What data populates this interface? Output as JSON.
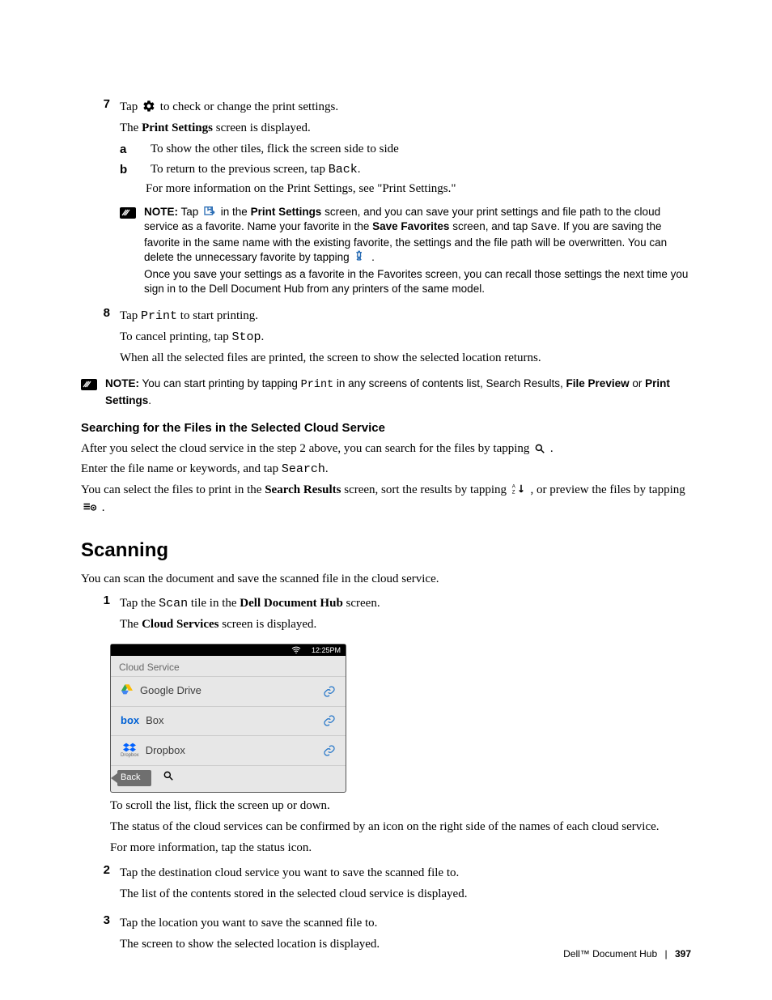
{
  "step7": {
    "num": "7",
    "line1_a": "Tap ",
    "line1_b": " to check or change the print settings.",
    "line2_a": "The ",
    "line2_bold": "Print Settings",
    "line2_b": " screen is displayed.",
    "a_num": "a",
    "a_text": "To show the other tiles, flick the screen side to side",
    "b_num": "b",
    "b_text_a": "To return to the previous screen, tap ",
    "b_text_mono": "Back",
    "b_text_b": ".",
    "b_followup": "For more information on the Print Settings, see \"Print Settings.\""
  },
  "note1": {
    "label": "NOTE:",
    "part_a": " Tap ",
    "part_b": " in the ",
    "bold1": "Print Settings",
    "part_c": " screen, and you can save your print settings and file path to the cloud service as a favorite. Name your favorite in the ",
    "bold2": "Save Favorites",
    "part_d": " screen, and tap ",
    "mono1": "Save",
    "part_e": ". If you are saving the favorite in the same name with the existing favorite, the settings and the file path will be overwritten. You can delete the unnecessary favorite by tapping ",
    "part_f": " .",
    "trail": "Once you save your settings as a favorite in the Favorites screen, you can recall those settings the next time you sign in to the Dell Document Hub from any printers of the same model."
  },
  "step8": {
    "num": "8",
    "line1_a": "Tap ",
    "mono1": "Print",
    "line1_b": " to start printing.",
    "line2_a": "To cancel printing, tap ",
    "mono2": "Stop",
    "line2_b": ".",
    "line3": "When all the selected files are printed, the screen to show the selected location returns."
  },
  "note2": {
    "label": "NOTE:",
    "a": " You can start printing by tapping ",
    "mono": "Print",
    "b": " in any screens of contents list, Search Results, ",
    "bold1": "File Preview",
    "c": " or ",
    "bold2": "Print Settings",
    "d": "."
  },
  "search_section": {
    "heading": "Searching for the Files in the Selected Cloud Service",
    "p1_a": "After you select the cloud service in the step 2 above, you can search for the files by tapping ",
    "p1_b": " .",
    "p2_a": "Enter the file name or keywords, and tap ",
    "p2_mono": "Search",
    "p2_b": ".",
    "p3_a": "You can select the files to print in the ",
    "p3_bold": "Search Results",
    "p3_b": " screen, sort the results by tapping ",
    "p3_c": " , or preview the files by tapping ",
    "p3_d": " ."
  },
  "scanning": {
    "heading": "Scanning",
    "intro": "You can scan the document and save the scanned file in the cloud service.",
    "s1": {
      "num": "1",
      "a": "Tap the ",
      "mono": "Scan",
      "b": " tile in the ",
      "bold": "Dell Document Hub",
      "c": " screen.",
      "d_a": "The ",
      "d_bold": "Cloud Services",
      "d_b": " screen is displayed."
    },
    "device": {
      "time": "12:25PM",
      "title": "Cloud Service",
      "gdrive": "Google Drive",
      "box_logo": "box",
      "box": "Box",
      "dropbox": "Dropbox",
      "dropbox_sub": "Dropbox",
      "back": "Back"
    },
    "after": {
      "scroll": "To scroll the list, flick the screen up or down.",
      "status": "The status of the cloud services can be confirmed by an icon on the right side of the names of each cloud service.",
      "more": "For more information, tap the status icon."
    },
    "s2": {
      "num": "2",
      "l1": "Tap the destination cloud service you want to save the scanned file to.",
      "l2": "The list of the contents stored in the selected cloud service is displayed."
    },
    "s3": {
      "num": "3",
      "l1": "Tap the location you want to save the scanned file to.",
      "l2": "The screen to show the selected location is displayed."
    }
  },
  "footer": {
    "title": "Dell™ Document Hub",
    "page": "397"
  }
}
